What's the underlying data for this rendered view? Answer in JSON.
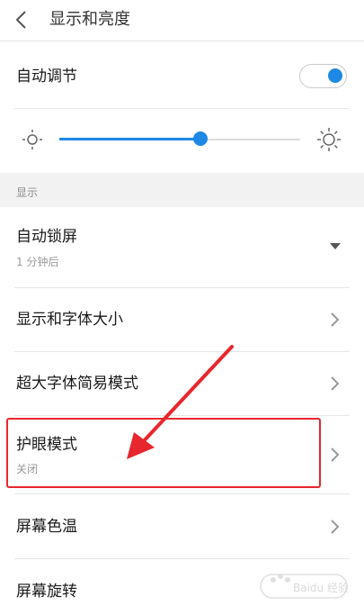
{
  "header": {
    "title": "显示和亮度"
  },
  "auto_adjust": {
    "label": "自动调节",
    "toggle_on": true
  },
  "brightness": {
    "level_percent": 58.6
  },
  "section": {
    "label": "显示"
  },
  "items": [
    {
      "label": "自动锁屏",
      "sub": "1 分钟后",
      "control": "dropdown"
    },
    {
      "label": "显示和字体大小",
      "control": "chevron"
    },
    {
      "label": "超大字体简易模式",
      "control": "chevron"
    },
    {
      "label": "护眼模式",
      "sub": "关闭",
      "control": "chevron",
      "highlighted": true
    },
    {
      "label": "屏幕色温",
      "control": "chevron"
    },
    {
      "label": "屏幕旋转",
      "control": "none"
    }
  ],
  "colors": {
    "accent": "#1e88e5",
    "annotation": "#e8262d"
  },
  "watermark": {
    "text": "Baidu 经验"
  }
}
